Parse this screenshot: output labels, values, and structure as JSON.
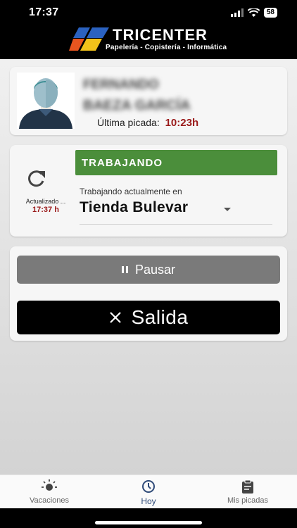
{
  "status_bar": {
    "time": "17:37",
    "battery": "58"
  },
  "header": {
    "brand": "TRICENTER",
    "tagline": "Papelería - Copistería - Informática"
  },
  "user_card": {
    "first_name": "FERNANDO",
    "last_names": "BAEZA GARCÍA",
    "last_punch_label": "Última picada:",
    "last_punch_time": "10:23h"
  },
  "status_card": {
    "updated_label": "Actualizado ...",
    "updated_time": "17:37 h",
    "status": "TRABAJANDO",
    "status_color": "#4b8e3b",
    "working_label": "Trabajando actualmente en",
    "location": "Tienda Bulevar"
  },
  "actions": {
    "pause_label": "Pausar",
    "exit_label": "Salida"
  },
  "tabs": [
    {
      "label": "Vacaciones",
      "icon": "sun-icon"
    },
    {
      "label": "Hoy",
      "icon": "clock-icon"
    },
    {
      "label": "Mis picadas",
      "icon": "clipboard-icon"
    }
  ],
  "colors": {
    "accent_red": "#9a1a1a",
    "active_tab": "#2e4a78"
  }
}
